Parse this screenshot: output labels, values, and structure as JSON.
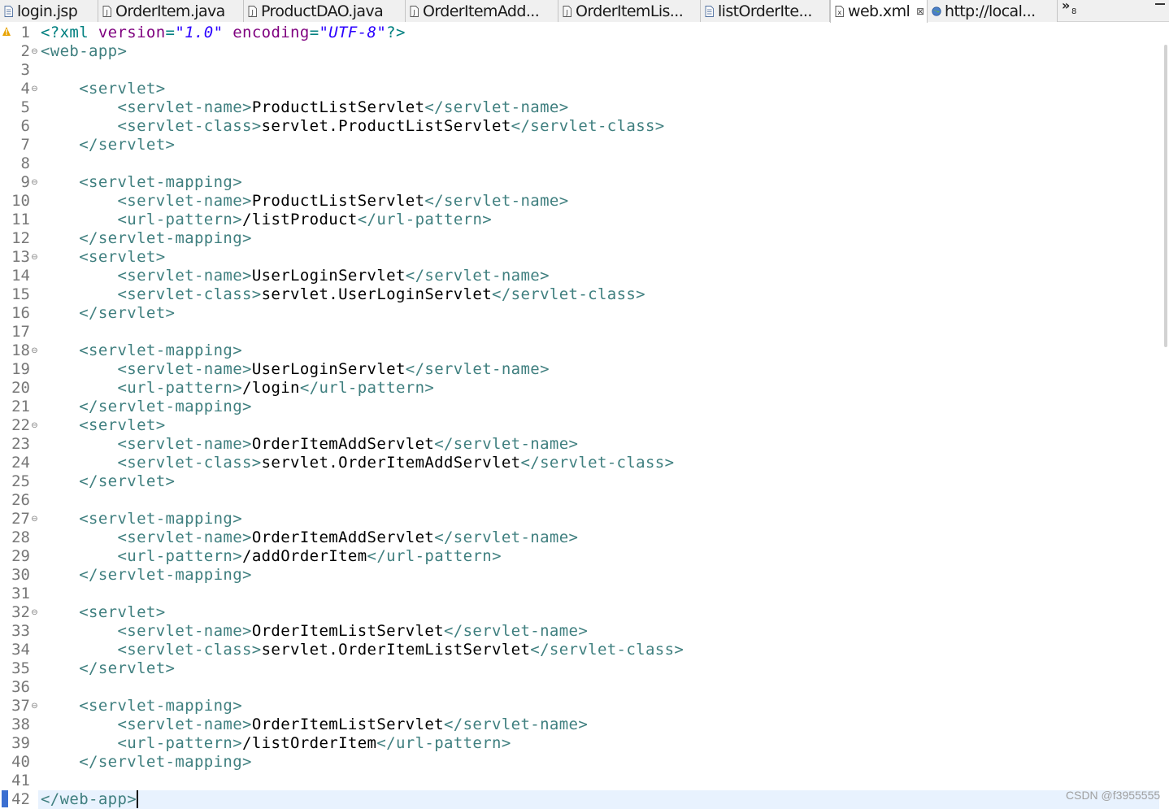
{
  "tabs": [
    {
      "label": "login.jsp",
      "icon": "jsp-file-icon",
      "active": false
    },
    {
      "label": "OrderItem.java",
      "icon": "java-file-icon",
      "active": false
    },
    {
      "label": "ProductDAO.java",
      "icon": "java-file-icon",
      "active": false
    },
    {
      "label": "OrderItemAdd...",
      "icon": "java-file-icon",
      "active": false
    },
    {
      "label": "OrderItemLis...",
      "icon": "java-file-icon",
      "active": false
    },
    {
      "label": "listOrderIte...",
      "icon": "jsp-file-icon",
      "active": false
    },
    {
      "label": "web.xml",
      "icon": "xml-file-icon",
      "active": true,
      "close": "⊠"
    },
    {
      "label": "http://local...",
      "icon": "globe-icon",
      "active": false
    }
  ],
  "overflow": {
    "chevron": "»",
    "count": "8"
  },
  "editor": {
    "current_line": 42,
    "lines": [
      {
        "n": "1",
        "fold": "",
        "code": [
          [
            "xml-pi",
            "<?xml "
          ],
          [
            "attr",
            "version"
          ],
          [
            "xml-pi",
            "="
          ],
          [
            "val",
            "\"1.0\""
          ],
          [
            "xml-pi",
            " "
          ],
          [
            "attr",
            "encoding"
          ],
          [
            "xml-pi",
            "="
          ],
          [
            "val",
            "\"UTF-8\""
          ],
          [
            "xml-pi",
            "?>"
          ]
        ]
      },
      {
        "n": "2",
        "fold": "⊖",
        "code": [
          [
            "t",
            "<web-app>"
          ]
        ]
      },
      {
        "n": "3",
        "fold": "",
        "code": []
      },
      {
        "n": "4",
        "fold": "⊖",
        "code": [
          [
            "txt",
            "    "
          ],
          [
            "t",
            "<servlet>"
          ]
        ]
      },
      {
        "n": "5",
        "fold": "",
        "code": [
          [
            "txt",
            "        "
          ],
          [
            "t",
            "<servlet-name>"
          ],
          [
            "txt",
            "ProductListServlet"
          ],
          [
            "t",
            "</servlet-name>"
          ]
        ]
      },
      {
        "n": "6",
        "fold": "",
        "code": [
          [
            "txt",
            "        "
          ],
          [
            "t",
            "<servlet-class>"
          ],
          [
            "txt",
            "servlet.ProductListServlet"
          ],
          [
            "t",
            "</servlet-class>"
          ]
        ]
      },
      {
        "n": "7",
        "fold": "",
        "code": [
          [
            "txt",
            "    "
          ],
          [
            "t",
            "</servlet>"
          ]
        ]
      },
      {
        "n": "8",
        "fold": "",
        "code": []
      },
      {
        "n": "9",
        "fold": "⊖",
        "code": [
          [
            "txt",
            "    "
          ],
          [
            "t",
            "<servlet-mapping>"
          ]
        ]
      },
      {
        "n": "10",
        "fold": "",
        "code": [
          [
            "txt",
            "        "
          ],
          [
            "t",
            "<servlet-name>"
          ],
          [
            "txt",
            "ProductListServlet"
          ],
          [
            "t",
            "</servlet-name>"
          ]
        ]
      },
      {
        "n": "11",
        "fold": "",
        "code": [
          [
            "txt",
            "        "
          ],
          [
            "t",
            "<url-pattern>"
          ],
          [
            "txt",
            "/listProduct"
          ],
          [
            "t",
            "</url-pattern>"
          ]
        ]
      },
      {
        "n": "12",
        "fold": "",
        "code": [
          [
            "txt",
            "    "
          ],
          [
            "t",
            "</servlet-mapping>"
          ]
        ]
      },
      {
        "n": "13",
        "fold": "⊖",
        "code": [
          [
            "txt",
            "    "
          ],
          [
            "t",
            "<servlet>"
          ]
        ]
      },
      {
        "n": "14",
        "fold": "",
        "code": [
          [
            "txt",
            "        "
          ],
          [
            "t",
            "<servlet-name>"
          ],
          [
            "txt",
            "UserLoginServlet"
          ],
          [
            "t",
            "</servlet-name>"
          ]
        ]
      },
      {
        "n": "15",
        "fold": "",
        "code": [
          [
            "txt",
            "        "
          ],
          [
            "t",
            "<servlet-class>"
          ],
          [
            "txt",
            "servlet.UserLoginServlet"
          ],
          [
            "t",
            "</servlet-class>"
          ]
        ]
      },
      {
        "n": "16",
        "fold": "",
        "code": [
          [
            "txt",
            "    "
          ],
          [
            "t",
            "</servlet>"
          ]
        ]
      },
      {
        "n": "17",
        "fold": "",
        "code": []
      },
      {
        "n": "18",
        "fold": "⊖",
        "code": [
          [
            "txt",
            "    "
          ],
          [
            "t",
            "<servlet-mapping>"
          ]
        ]
      },
      {
        "n": "19",
        "fold": "",
        "code": [
          [
            "txt",
            "        "
          ],
          [
            "t",
            "<servlet-name>"
          ],
          [
            "txt",
            "UserLoginServlet"
          ],
          [
            "t",
            "</servlet-name>"
          ]
        ]
      },
      {
        "n": "20",
        "fold": "",
        "code": [
          [
            "txt",
            "        "
          ],
          [
            "t",
            "<url-pattern>"
          ],
          [
            "txt",
            "/login"
          ],
          [
            "t",
            "</url-pattern>"
          ]
        ]
      },
      {
        "n": "21",
        "fold": "",
        "code": [
          [
            "txt",
            "    "
          ],
          [
            "t",
            "</servlet-mapping>"
          ]
        ]
      },
      {
        "n": "22",
        "fold": "⊖",
        "code": [
          [
            "txt",
            "    "
          ],
          [
            "t",
            "<servlet>"
          ]
        ]
      },
      {
        "n": "23",
        "fold": "",
        "code": [
          [
            "txt",
            "        "
          ],
          [
            "t",
            "<servlet-name>"
          ],
          [
            "txt",
            "OrderItemAddServlet"
          ],
          [
            "t",
            "</servlet-name>"
          ]
        ]
      },
      {
        "n": "24",
        "fold": "",
        "code": [
          [
            "txt",
            "        "
          ],
          [
            "t",
            "<servlet-class>"
          ],
          [
            "txt",
            "servlet.OrderItemAddServlet"
          ],
          [
            "t",
            "</servlet-class>"
          ]
        ]
      },
      {
        "n": "25",
        "fold": "",
        "code": [
          [
            "txt",
            "    "
          ],
          [
            "t",
            "</servlet>"
          ]
        ]
      },
      {
        "n": "26",
        "fold": "",
        "code": []
      },
      {
        "n": "27",
        "fold": "⊖",
        "code": [
          [
            "txt",
            "    "
          ],
          [
            "t",
            "<servlet-mapping>"
          ]
        ]
      },
      {
        "n": "28",
        "fold": "",
        "code": [
          [
            "txt",
            "        "
          ],
          [
            "t",
            "<servlet-name>"
          ],
          [
            "txt",
            "OrderItemAddServlet"
          ],
          [
            "t",
            "</servlet-name>"
          ]
        ]
      },
      {
        "n": "29",
        "fold": "",
        "code": [
          [
            "txt",
            "        "
          ],
          [
            "t",
            "<url-pattern>"
          ],
          [
            "txt",
            "/addOrderItem"
          ],
          [
            "t",
            "</url-pattern>"
          ]
        ]
      },
      {
        "n": "30",
        "fold": "",
        "code": [
          [
            "txt",
            "    "
          ],
          [
            "t",
            "</servlet-mapping>"
          ]
        ]
      },
      {
        "n": "31",
        "fold": "",
        "code": []
      },
      {
        "n": "32",
        "fold": "⊖",
        "code": [
          [
            "txt",
            "    "
          ],
          [
            "t",
            "<servlet>"
          ]
        ]
      },
      {
        "n": "33",
        "fold": "",
        "code": [
          [
            "txt",
            "        "
          ],
          [
            "t",
            "<servlet-name>"
          ],
          [
            "txt",
            "OrderItemListServlet"
          ],
          [
            "t",
            "</servlet-name>"
          ]
        ]
      },
      {
        "n": "34",
        "fold": "",
        "code": [
          [
            "txt",
            "        "
          ],
          [
            "t",
            "<servlet-class>"
          ],
          [
            "txt",
            "servlet.OrderItemListServlet"
          ],
          [
            "t",
            "</servlet-class>"
          ]
        ]
      },
      {
        "n": "35",
        "fold": "",
        "code": [
          [
            "txt",
            "    "
          ],
          [
            "t",
            "</servlet>"
          ]
        ]
      },
      {
        "n": "36",
        "fold": "",
        "code": []
      },
      {
        "n": "37",
        "fold": "⊖",
        "code": [
          [
            "txt",
            "    "
          ],
          [
            "t",
            "<servlet-mapping>"
          ]
        ]
      },
      {
        "n": "38",
        "fold": "",
        "code": [
          [
            "txt",
            "        "
          ],
          [
            "t",
            "<servlet-name>"
          ],
          [
            "txt",
            "OrderItemListServlet"
          ],
          [
            "t",
            "</servlet-name>"
          ]
        ]
      },
      {
        "n": "39",
        "fold": "",
        "code": [
          [
            "txt",
            "        "
          ],
          [
            "t",
            "<url-pattern>"
          ],
          [
            "txt",
            "/listOrderItem"
          ],
          [
            "t",
            "</url-pattern>"
          ]
        ]
      },
      {
        "n": "40",
        "fold": "",
        "code": [
          [
            "txt",
            "    "
          ],
          [
            "t",
            "</servlet-mapping>"
          ]
        ]
      },
      {
        "n": "41",
        "fold": "",
        "code": []
      },
      {
        "n": "42",
        "fold": "",
        "code": [
          [
            "t",
            "</web-app>"
          ]
        ]
      }
    ]
  },
  "markers": {
    "warning_icon": "warning-icon",
    "warning_color": "#e8a200"
  },
  "colors": {
    "tag": "#3f7f7f",
    "text": "#000000",
    "attribute": "#7f007f",
    "value": "#2a00ff",
    "current_line": "#e8f2fe"
  },
  "watermark": "CSDN @f3955555"
}
